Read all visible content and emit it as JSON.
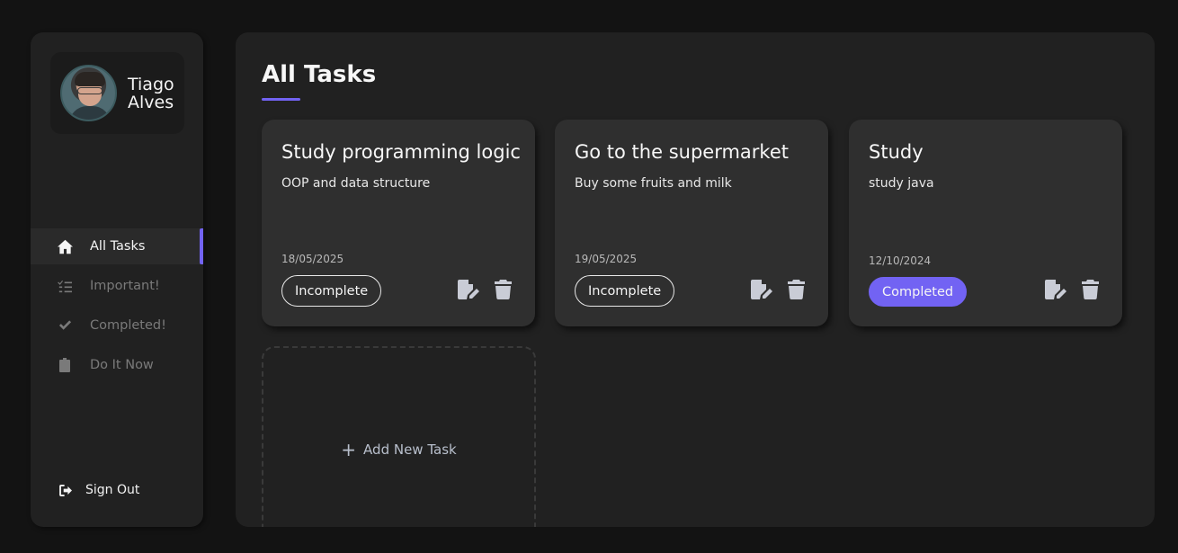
{
  "user": {
    "first_name": "Tiago",
    "last_name": "Alves"
  },
  "nav": {
    "items": [
      {
        "label": "All Tasks",
        "icon": "home-icon",
        "active": true
      },
      {
        "label": "Important!",
        "icon": "list-check-icon",
        "active": false
      },
      {
        "label": "Completed!",
        "icon": "check-icon",
        "active": false
      },
      {
        "label": "Do It Now",
        "icon": "clipboard-icon",
        "active": false
      }
    ],
    "sign_out": "Sign Out"
  },
  "main": {
    "title": "All Tasks",
    "add_task_label": "Add New Task",
    "tasks": [
      {
        "title": "Study programming logic",
        "description": "OOP and data structure",
        "date": "18/05/2025",
        "status": "Incomplete"
      },
      {
        "title": "Go to the supermarket",
        "description": "Buy some fruits and milk",
        "date": "19/05/2025",
        "status": "Incomplete"
      },
      {
        "title": "Study",
        "description": "study java",
        "date": "12/10/2024",
        "status": "Completed"
      }
    ]
  },
  "colors": {
    "accent": "#7263f3",
    "background": "#131313",
    "panel": "#212121",
    "card": "#2f2f2f"
  }
}
